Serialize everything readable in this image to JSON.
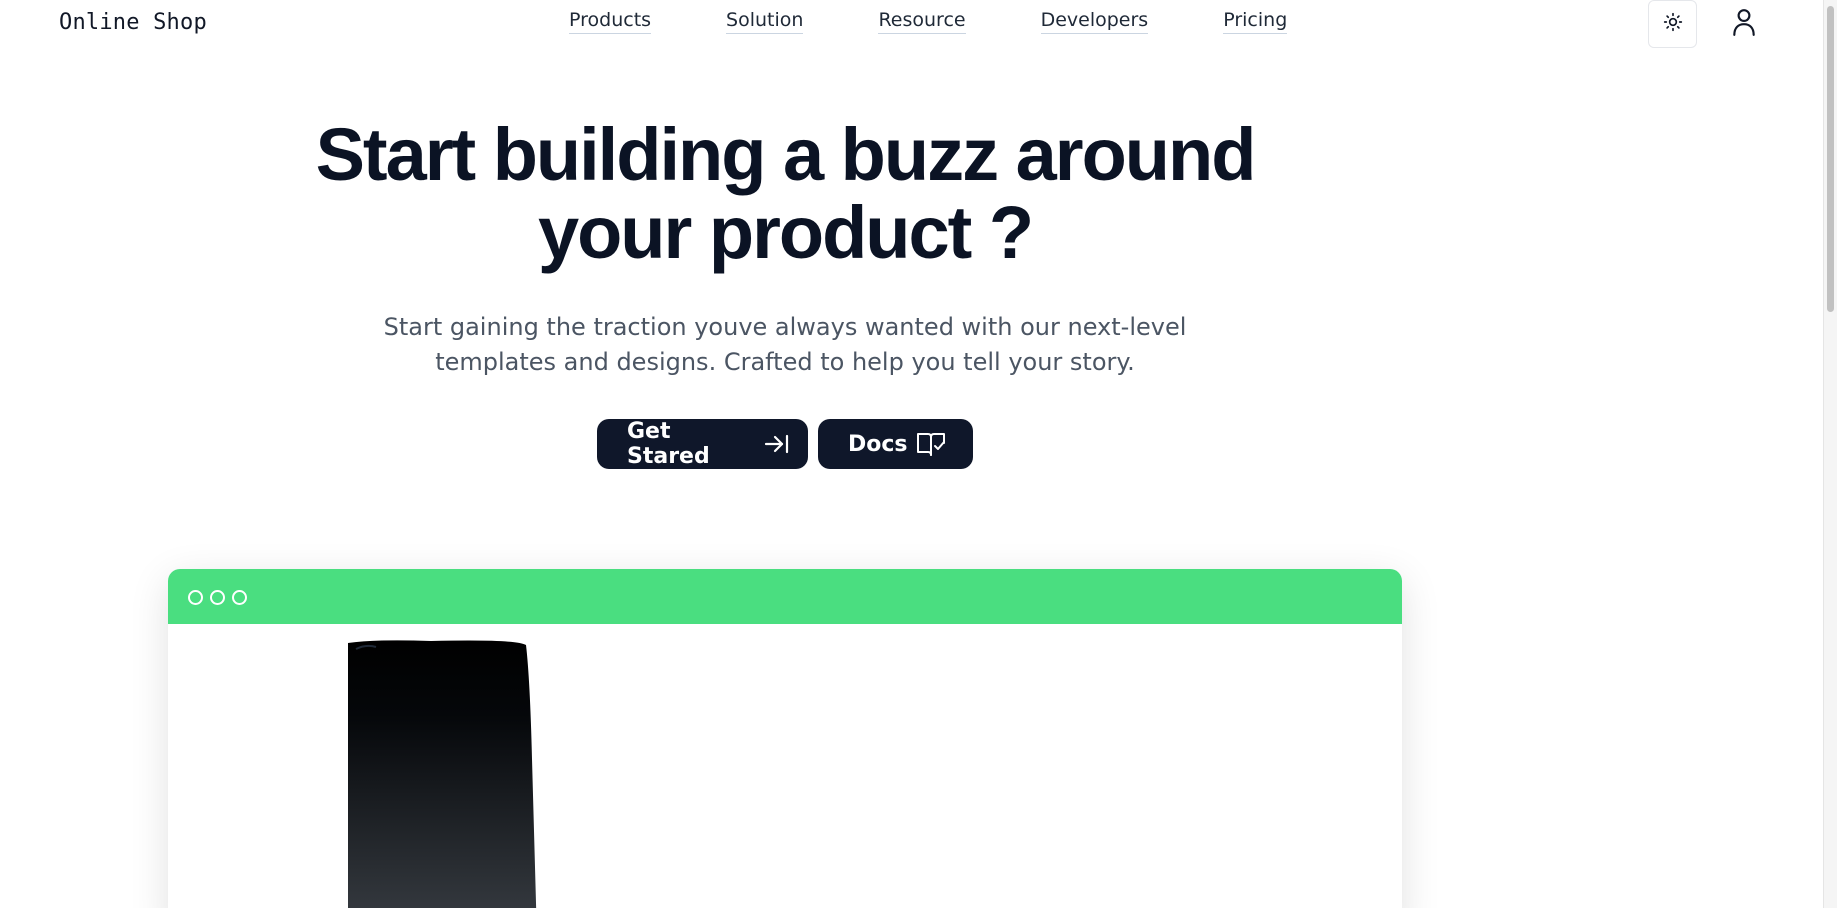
{
  "header": {
    "logo": "Online Shop",
    "nav": [
      {
        "label": "Products"
      },
      {
        "label": "Solution"
      },
      {
        "label": "Resource"
      },
      {
        "label": "Developers"
      },
      {
        "label": "Pricing"
      }
    ],
    "theme_icon": "sun-icon",
    "user_icon": "user-icon"
  },
  "hero": {
    "title_line1": "Start building a buzz around",
    "title_line2": "your product ?",
    "subtitle_line1": "Start gaining the traction youve always wanted with our next-level",
    "subtitle_line2": "templates and designs. Crafted to help you tell your story.",
    "buttons": {
      "get_started": "Get Stared",
      "docs": "Docs"
    }
  },
  "preview": {
    "bar_color": "#4ade80",
    "icons": [
      "window-dot-icon",
      "window-dot-icon",
      "window-dot-icon"
    ]
  },
  "colors": {
    "button_bg": "#0f172a",
    "text_dark": "#0b1324",
    "text_muted": "#4b5563"
  }
}
